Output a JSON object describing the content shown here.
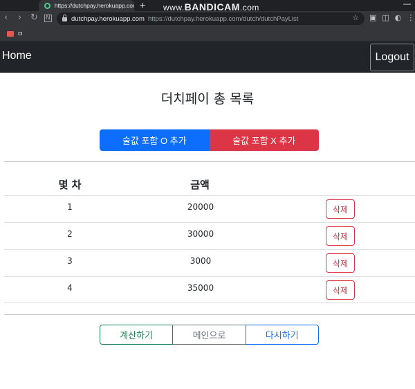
{
  "browser": {
    "tab_title": "https://dutchpay.herokuapp.com",
    "new_tab": "+",
    "watermark_prefix": "www.",
    "watermark_brand": "BANDICAM",
    "watermark_suffix": ".com",
    "url_host": "dutchpay.herokuapp.com",
    "url_full": "https://dutchpay.herokuapp.com/dutch/dutchPayList",
    "bookmark_label": "ㅁ",
    "back": "‹",
    "forward": "›",
    "reload": "↻"
  },
  "navbar": {
    "home": "Home",
    "logout": "Logout"
  },
  "page": {
    "title": "더치페이 총 목록",
    "btn_with_alcohol": "술값 포함 O 추가",
    "btn_without_alcohol": "술값 포함 X 추가"
  },
  "table": {
    "headers": [
      "몇 차",
      "금액"
    ],
    "delete_label": "삭제",
    "rows": [
      {
        "round": "1",
        "amount": "20000"
      },
      {
        "round": "2",
        "amount": "30000"
      },
      {
        "round": "3",
        "amount": "3000"
      },
      {
        "round": "4",
        "amount": "35000"
      }
    ]
  },
  "actions": {
    "calculate": "계산하기",
    "main": "메인으로",
    "retry": "다시하기"
  },
  "colors": {
    "primary": "#0d6efd",
    "danger": "#dc3545",
    "success": "#198754",
    "secondary": "#6c757d",
    "navbar": "#212529"
  }
}
